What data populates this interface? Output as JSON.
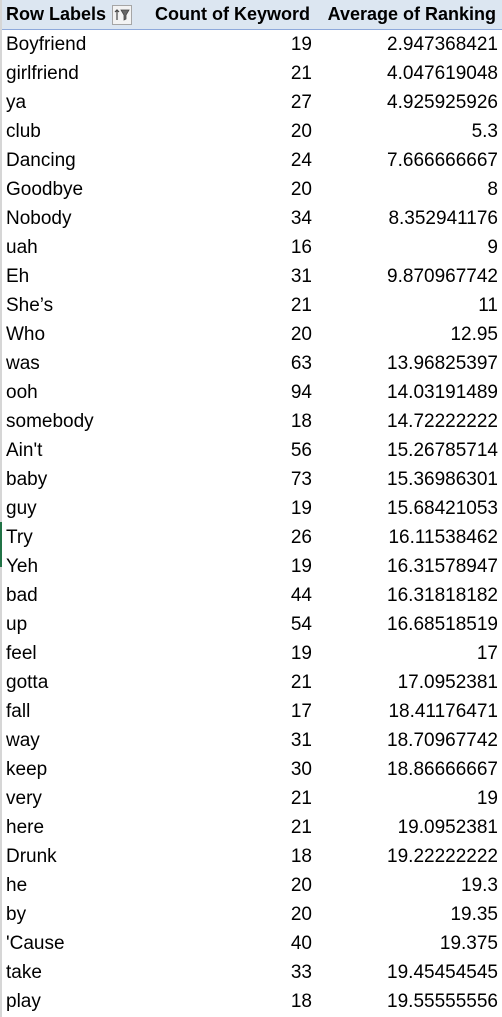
{
  "header": {
    "col1": "Row Labels",
    "col2": "Count of Keyword",
    "col3": "Average of Ranking",
    "filter_icon": "sort-filter-icon"
  },
  "colors": {
    "header_bg": "#dce6f1",
    "header_border": "#8ea9db",
    "selection_green": "#217346"
  },
  "rows": [
    {
      "label": "Boyfriend",
      "count": "19",
      "avg": "2.947368421"
    },
    {
      "label": "girlfriend",
      "count": "21",
      "avg": "4.047619048"
    },
    {
      "label": "ya",
      "count": "27",
      "avg": "4.925925926"
    },
    {
      "label": "club",
      "count": "20",
      "avg": "5.3"
    },
    {
      "label": "Dancing",
      "count": "24",
      "avg": "7.666666667"
    },
    {
      "label": "Goodbye",
      "count": "20",
      "avg": "8"
    },
    {
      "label": "Nobody",
      "count": "34",
      "avg": "8.352941176"
    },
    {
      "label": "uah",
      "count": "16",
      "avg": "9"
    },
    {
      "label": "Eh",
      "count": "31",
      "avg": "9.870967742"
    },
    {
      "label": "She’s",
      "count": "21",
      "avg": "11"
    },
    {
      "label": "Who",
      "count": "20",
      "avg": "12.95"
    },
    {
      "label": "was",
      "count": "63",
      "avg": "13.96825397"
    },
    {
      "label": "ooh",
      "count": "94",
      "avg": "14.03191489"
    },
    {
      "label": "somebody",
      "count": "18",
      "avg": "14.72222222"
    },
    {
      "label": "Ain't",
      "count": "56",
      "avg": "15.26785714"
    },
    {
      "label": "baby",
      "count": "73",
      "avg": "15.36986301"
    },
    {
      "label": "guy",
      "count": "19",
      "avg": "15.68421053"
    },
    {
      "label": "Try",
      "count": "26",
      "avg": "16.11538462"
    },
    {
      "label": "Yeh",
      "count": "19",
      "avg": "16.31578947"
    },
    {
      "label": "bad",
      "count": "44",
      "avg": "16.31818182"
    },
    {
      "label": "up",
      "count": "54",
      "avg": "16.68518519"
    },
    {
      "label": "feel",
      "count": "19",
      "avg": "17"
    },
    {
      "label": "gotta",
      "count": "21",
      "avg": "17.0952381"
    },
    {
      "label": "fall",
      "count": "17",
      "avg": "18.41176471"
    },
    {
      "label": "way",
      "count": "31",
      "avg": "18.70967742"
    },
    {
      "label": "keep",
      "count": "30",
      "avg": "18.86666667"
    },
    {
      "label": "very",
      "count": "21",
      "avg": "19"
    },
    {
      "label": "here",
      "count": "21",
      "avg": "19.0952381"
    },
    {
      "label": "Drunk",
      "count": "18",
      "avg": "19.22222222"
    },
    {
      "label": "he",
      "count": "20",
      "avg": "19.3"
    },
    {
      "label": "by",
      "count": "20",
      "avg": "19.35"
    },
    {
      "label": "'Cause",
      "count": "40",
      "avg": "19.375"
    },
    {
      "label": "take",
      "count": "33",
      "avg": "19.45454545"
    },
    {
      "label": "play",
      "count": "18",
      "avg": "19.55555556"
    }
  ]
}
